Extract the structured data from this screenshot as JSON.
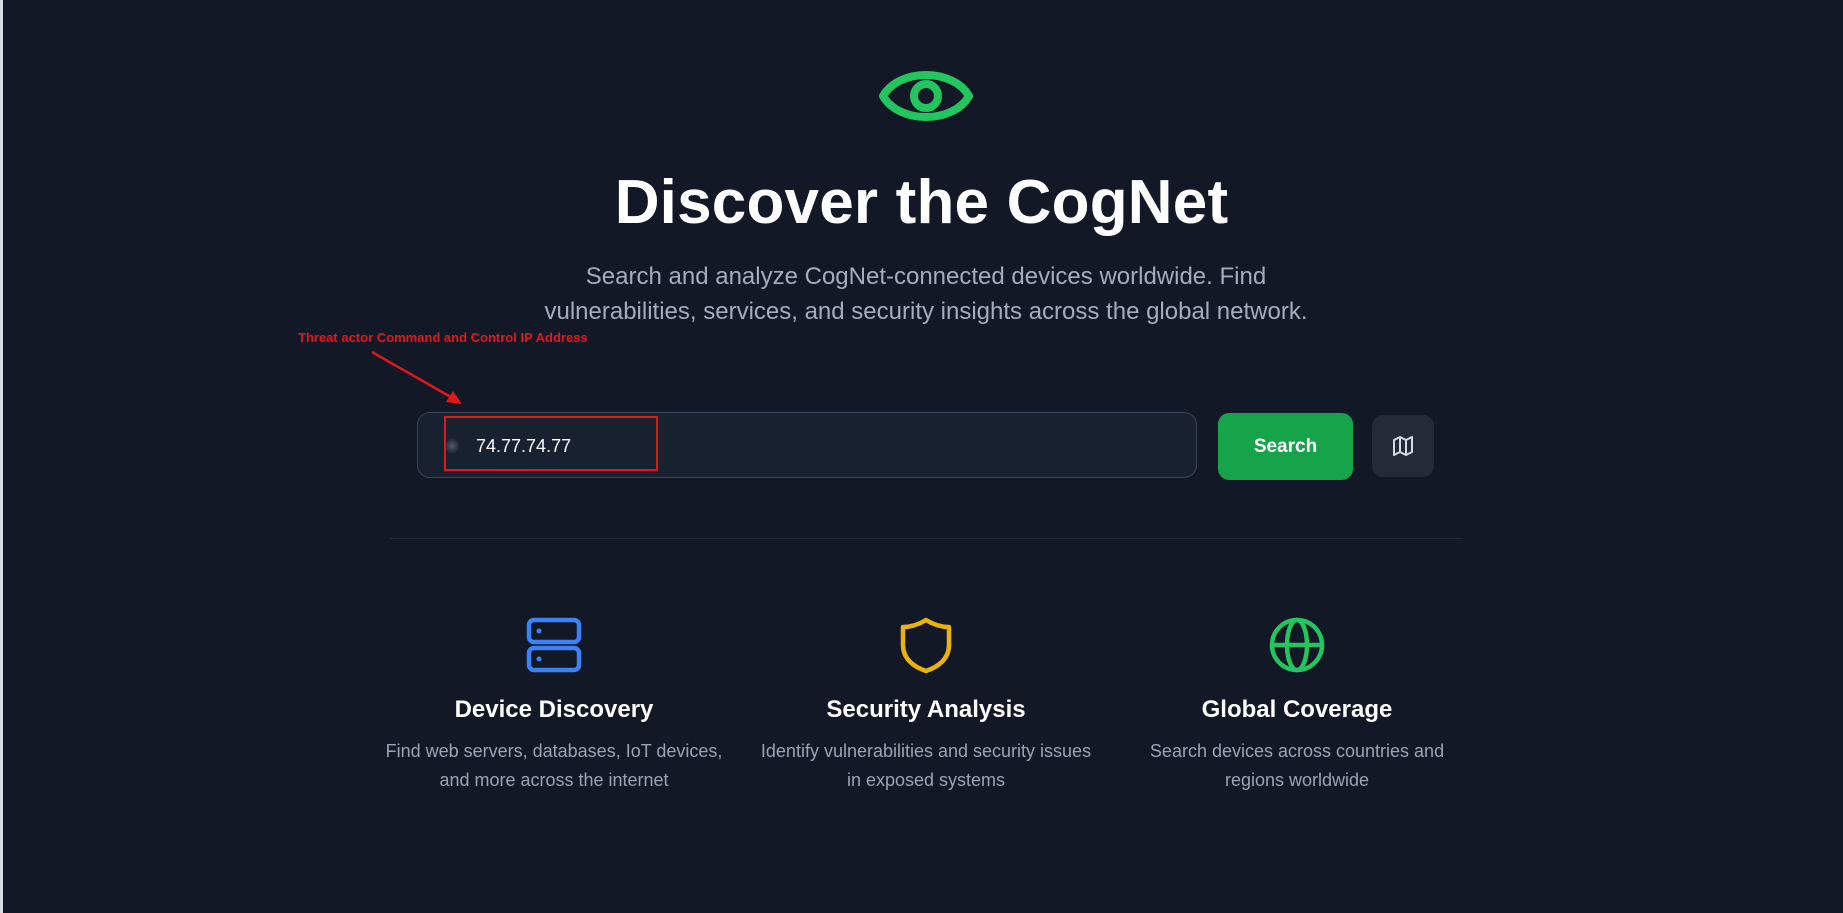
{
  "hero": {
    "icon": "eye-icon",
    "title": "Discover the CogNet",
    "subtitle": "Search and analyze CogNet-connected devices worldwide. Find vulnerabilities, services, and security insights across the global network."
  },
  "annotation": {
    "label": "Threat actor Command and Control IP Address",
    "color": "#e0161b"
  },
  "search": {
    "value": "74.77.74.77",
    "button_label": "Search",
    "map_icon": "map-icon"
  },
  "features": [
    {
      "icon": "server-icon",
      "title": "Device Discovery",
      "description": "Find web servers, databases, IoT devices, and more across the internet",
      "color": "#3b82f6"
    },
    {
      "icon": "shield-icon",
      "title": "Security Analysis",
      "description": "Identify vulnerabilities and security issues in exposed systems",
      "color": "#eab308"
    },
    {
      "icon": "globe-icon",
      "title": "Global Coverage",
      "description": "Search devices across countries and regions worldwide",
      "color": "#22c55e"
    }
  ],
  "colors": {
    "background": "#121826",
    "accent_green": "#16a34a",
    "text_muted": "#a3adbd"
  }
}
